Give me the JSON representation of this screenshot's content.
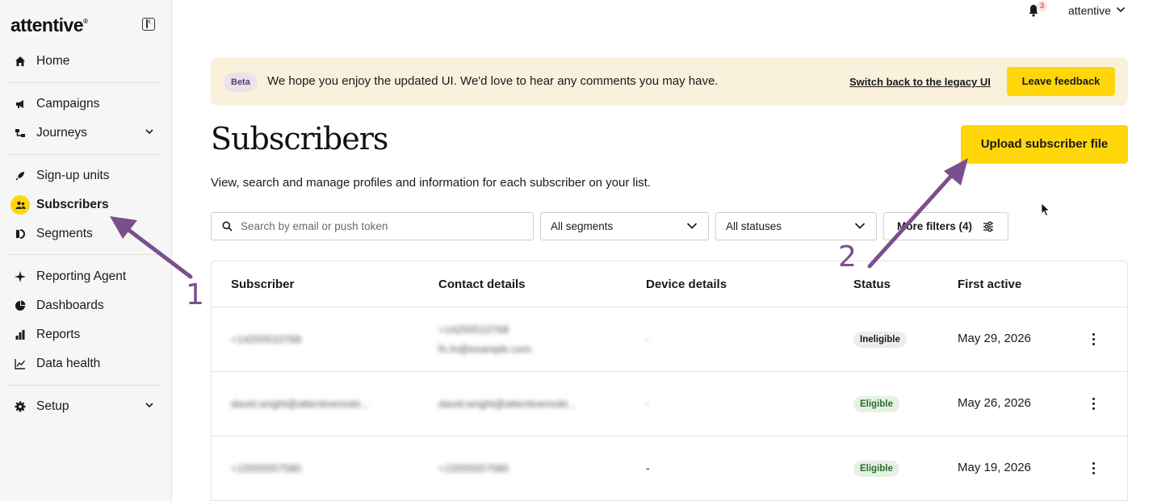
{
  "brand": {
    "logo": "attentive",
    "trademark": "®"
  },
  "sidebar": {
    "items": [
      {
        "label": "Home",
        "icon": "home-icon"
      },
      {
        "label": "Campaigns",
        "icon": "megaphone-icon"
      },
      {
        "label": "Journeys",
        "icon": "journeys-icon",
        "expandable": true
      },
      {
        "label": "Sign-up units",
        "icon": "rocket-icon"
      },
      {
        "label": "Subscribers",
        "icon": "subscribers-icon",
        "active": true
      },
      {
        "label": "Segments",
        "icon": "segments-icon"
      },
      {
        "label": "Reporting Agent",
        "icon": "sparkle-icon"
      },
      {
        "label": "Dashboards",
        "icon": "pie-chart-icon"
      },
      {
        "label": "Reports",
        "icon": "bar-chart-icon"
      },
      {
        "label": "Data health",
        "icon": "line-chart-icon"
      },
      {
        "label": "Setup",
        "icon": "gear-icon",
        "expandable": true
      }
    ]
  },
  "topbar": {
    "notification_count": "3",
    "account_name": "attentive"
  },
  "banner": {
    "badge": "Beta",
    "message": "We hope you enjoy the updated UI. We'd love to hear any comments you may have.",
    "legacy_link": "Switch back to the legacy UI",
    "feedback_button": "Leave feedback"
  },
  "page": {
    "title": "Subscribers",
    "subtitle": "View, search and manage profiles and information for each subscriber on your list.",
    "upload_button": "Upload subscriber file"
  },
  "filters": {
    "search_placeholder": "Search by email or push token",
    "segments": "All segments",
    "statuses": "All statuses",
    "more_filters": "More filters (4)"
  },
  "table": {
    "columns": [
      "Subscriber",
      "Contact details",
      "Device details",
      "Status",
      "First active"
    ],
    "rows": [
      {
        "subscriber": "+14255510768",
        "contact_line1": "+14255510768",
        "contact_line2": "fn.ln@example.com",
        "device": "-",
        "status": "Ineligible",
        "first_active": "May 29, 2026"
      },
      {
        "subscriber": "david.wright@attentivemobi...",
        "contact_line1": "david.wright@attentivemobi...",
        "contact_line2": "",
        "device": "-",
        "status": "Eligible",
        "first_active": "May 26, 2026"
      },
      {
        "subscriber": "+15555557580",
        "contact_line1": "+15555557580",
        "contact_line2": "",
        "device": "-",
        "status": "Eligible",
        "first_active": "May 19, 2026"
      }
    ]
  },
  "annotations": {
    "first": "1",
    "second": "2",
    "color": "#7b4f8e"
  },
  "colors": {
    "accent": "#ffd60a",
    "banner_bg": "#f9f1dc",
    "eligible_bg": "#e3f2e2",
    "eligible_fg": "#2e6b2b"
  }
}
